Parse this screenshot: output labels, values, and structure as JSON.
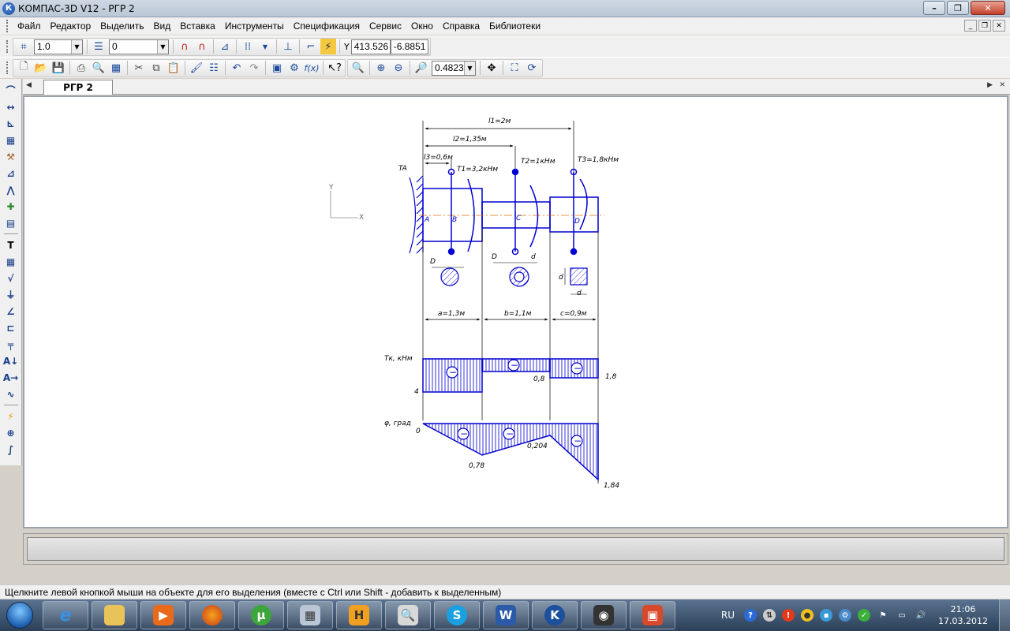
{
  "window": {
    "title": "КОМПАС-3D V12 - РГР 2",
    "app_icon": "К"
  },
  "menu": {
    "items": [
      "Файл",
      "Редактор",
      "Выделить",
      "Вид",
      "Вставка",
      "Инструменты",
      "Спецификация",
      "Сервис",
      "Окно",
      "Справка",
      "Библиотеки"
    ]
  },
  "toolbar1": {
    "step_value": "1.0",
    "layer_value": "0",
    "coord_x": "413.526",
    "coord_y": "-6.8851"
  },
  "toolbar2": {
    "zoom_value": "0.4823"
  },
  "tabs": {
    "active_label": "РГР 2"
  },
  "drawing": {
    "axis_x": "X",
    "axis_y": "Y",
    "dim_l1": "l1=2м",
    "dim_l2": "l2=1,35м",
    "dim_l3": "l3=0,6м",
    "torque_A": "TA",
    "torque_1": "T1=3,2кНм",
    "torque_2": "T2=1кНм",
    "torque_3": "T3=1,8кНм",
    "point_A": "A",
    "point_B": "B",
    "point_C": "C",
    "point_D": "D",
    "sec1_D": "D",
    "sec2_D": "D",
    "sec2_d": "d",
    "sec3_d_left": "d",
    "sec3_d_bottom": "d",
    "dim_a": "a=1,3м",
    "dim_b": "b=1,1м",
    "dim_c": "c=0,9м",
    "tk_label": "Tк, кНм",
    "tk_val_4": "4",
    "tk_val_08": "0,8",
    "tk_val_18": "1,8",
    "phi_label": "φ, град",
    "phi_val_0": "0",
    "phi_val_078": "0,78",
    "phi_val_0204": "0,204",
    "phi_val_184": "1,84",
    "minus": "−",
    "line_color": "#0000d0",
    "axis_color": "#e07000"
  },
  "status": {
    "message": "Щелкните левой кнопкой мыши на объекте для его выделения (вместе с Ctrl или Shift - добавить к выделенным)"
  },
  "taskbar": {
    "apps": [
      "ie-icon",
      "explorer-icon",
      "media-player-icon",
      "firefox-icon",
      "utorrent-icon",
      "calculator-icon",
      "h-app-icon",
      "search-app-icon",
      "skype-icon",
      "word-icon",
      "kompas-icon",
      "camera-icon",
      "presentation-icon"
    ],
    "tray_lang": "RU",
    "time": "21:06",
    "date": "17.03.2012"
  }
}
